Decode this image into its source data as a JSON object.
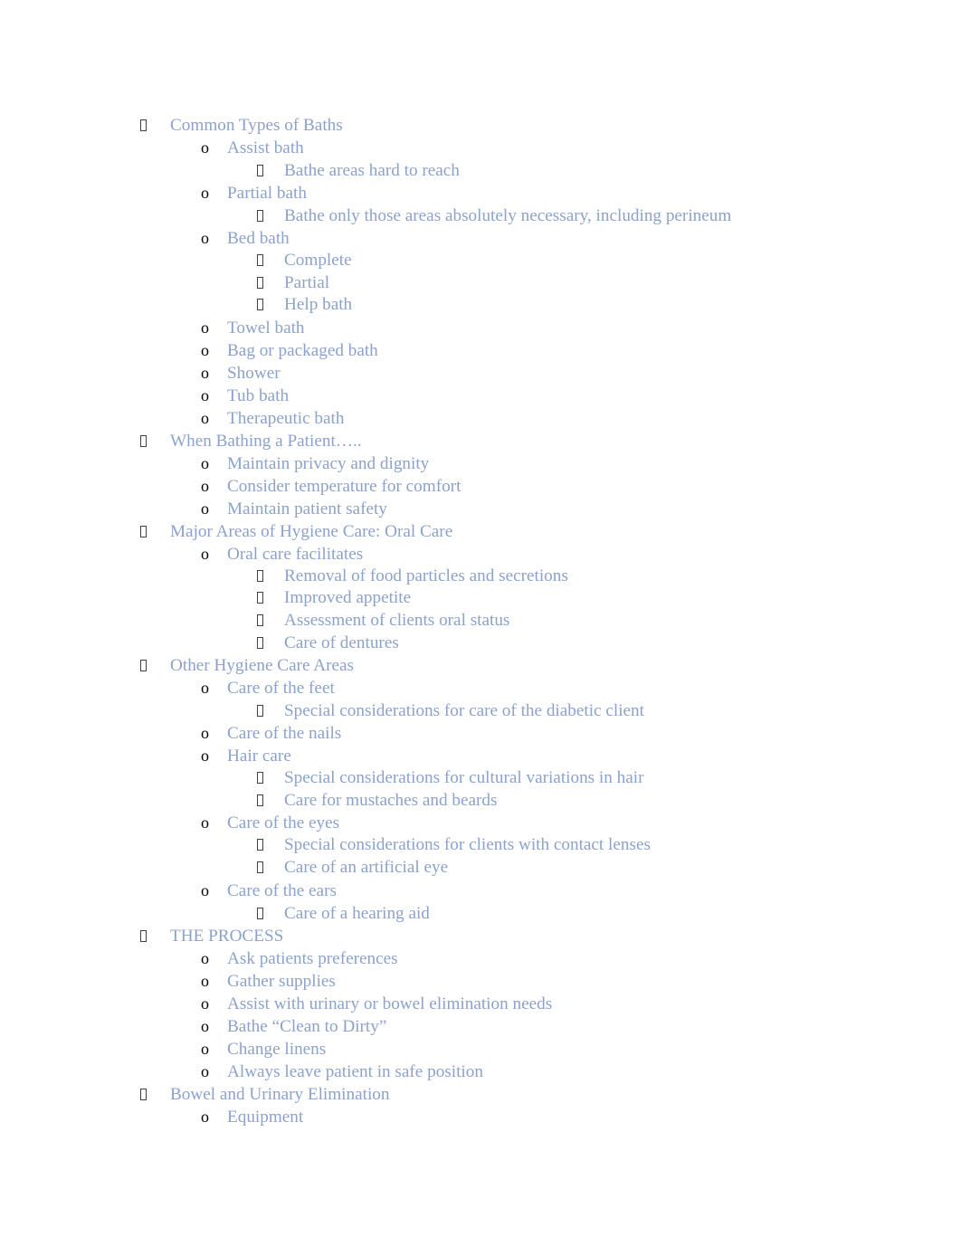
{
  "document": {
    "background_color": "#ffffff",
    "text_color": "#8ca2cc",
    "marker_color": "#404040",
    "o_marker_color": "#000000",
    "bullet_glyphs": {
      "level1": "missing-glyph-box",
      "level2": "o",
      "level3": "missing-glyph-box"
    }
  },
  "outline": [
    {
      "level": 1,
      "text": "Common Types of Baths",
      "tight": false
    },
    {
      "level": 2,
      "text": "Assist bath",
      "tight": false
    },
    {
      "level": 3,
      "text": "Bathe areas hard to reach",
      "tight": false
    },
    {
      "level": 2,
      "text": "Partial bath",
      "tight": false
    },
    {
      "level": 3,
      "text": "Bathe only those areas absolutely necessary, including perineum",
      "tight": false
    },
    {
      "level": 2,
      "text": "Bed bath",
      "tight": false
    },
    {
      "level": 3,
      "text": "Complete",
      "tight": true
    },
    {
      "level": 3,
      "text": "Partial",
      "tight": true
    },
    {
      "level": 3,
      "text": "Help bath",
      "tight": true
    },
    {
      "level": 2,
      "text": "Towel bath",
      "tight": false
    },
    {
      "level": 2,
      "text": "Bag or packaged bath",
      "tight": false
    },
    {
      "level": 2,
      "text": "Shower",
      "tight": false
    },
    {
      "level": 2,
      "text": "Tub bath",
      "tight": false
    },
    {
      "level": 2,
      "text": "Therapeutic bath",
      "tight": false
    },
    {
      "level": 1,
      "text": "When Bathing a Patient…..",
      "tight": false
    },
    {
      "level": 2,
      "text": "Maintain privacy and dignity",
      "tight": false
    },
    {
      "level": 2,
      "text": "Consider temperature for comfort",
      "tight": false
    },
    {
      "level": 2,
      "text": "Maintain patient safety",
      "tight": false
    },
    {
      "level": 1,
      "text": "Major Areas of Hygiene Care: Oral Care",
      "tight": false
    },
    {
      "level": 2,
      "text": "Oral care facilitates",
      "tight": false
    },
    {
      "level": 3,
      "text": "Removal of food particles and secretions",
      "tight": true
    },
    {
      "level": 3,
      "text": "Improved appetite",
      "tight": true
    },
    {
      "level": 3,
      "text": "Assessment of clients oral status",
      "tight": true
    },
    {
      "level": 3,
      "text": "Care of dentures",
      "tight": true
    },
    {
      "level": 1,
      "text": "Other Hygiene Care Areas",
      "tight": false
    },
    {
      "level": 2,
      "text": "Care of the feet",
      "tight": false
    },
    {
      "level": 3,
      "text": "Special considerations for care of the diabetic client",
      "tight": false
    },
    {
      "level": 2,
      "text": "Care of the nails",
      "tight": false
    },
    {
      "level": 2,
      "text": "Hair care",
      "tight": false
    },
    {
      "level": 3,
      "text": "Special considerations for cultural variations in hair",
      "tight": true
    },
    {
      "level": 3,
      "text": "Care for mustaches and beards",
      "tight": true
    },
    {
      "level": 2,
      "text": "Care of the eyes",
      "tight": false
    },
    {
      "level": 3,
      "text": "Special considerations for clients with contact lenses",
      "tight": true
    },
    {
      "level": 3,
      "text": "Care of an artificial eye",
      "tight": true
    },
    {
      "level": 2,
      "text": "Care of the ears",
      "tight": false
    },
    {
      "level": 3,
      "text": "Care of a hearing aid",
      "tight": false
    },
    {
      "level": 1,
      "text": "THE PROCESS",
      "tight": false
    },
    {
      "level": 2,
      "text": "Ask patients preferences",
      "tight": false
    },
    {
      "level": 2,
      "text": "Gather supplies",
      "tight": false
    },
    {
      "level": 2,
      "text": "Assist with urinary or bowel elimination needs",
      "tight": false
    },
    {
      "level": 2,
      "text": "Bathe “Clean to Dirty”",
      "tight": false
    },
    {
      "level": 2,
      "text": "Change linens",
      "tight": false
    },
    {
      "level": 2,
      "text": "Always leave patient in safe position",
      "tight": false
    },
    {
      "level": 1,
      "text": "Bowel and Urinary Elimination",
      "tight": false
    },
    {
      "level": 2,
      "text": "Equipment",
      "tight": false
    }
  ]
}
